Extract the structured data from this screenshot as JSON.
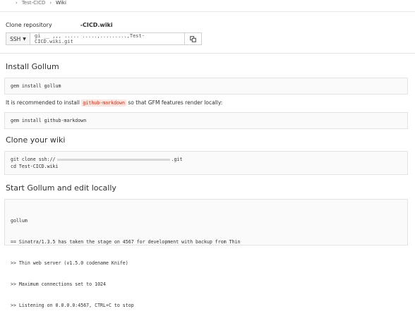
{
  "breadcrumb": {
    "sep": "›",
    "item1": "Test-CICD",
    "item2": "Wiki"
  },
  "clone": {
    "label": "Clone repository",
    "repo_name": "-CICD.wiki",
    "protocol": "SSH",
    "url": "gi __ ,,, ..... .....,.........,Test-CICD.wiki.git"
  },
  "sections": {
    "install": {
      "title": "Install Gollum",
      "code": "gem install gollum"
    },
    "note": {
      "before": "It is recommended to install ",
      "code": "github-markdown",
      "after": " so that GFM features render locally:"
    },
    "install2": {
      "code": "gem install github-markdown"
    },
    "clone_wiki": {
      "title": "Clone your wiki",
      "line1_start": "git clone ssh://",
      "line1_end": ".git",
      "line2": "cd Test-CICD.wiki"
    },
    "start": {
      "title": "Start Gollum and edit locally",
      "lines": [
        "gollum",
        "== Sinatra/1.3.5 has taken the stage on 4567 for development with backup from Thin",
        ">> Thin web server (v1.5.0 codename Knife)",
        ">> Maximum connections set to 1024",
        ">> Listening on 0.0.0.0:4567, CTRL+C to stop"
      ]
    }
  },
  "icons": {
    "copy": "copy-icon",
    "caret": "chevron-down-icon"
  }
}
